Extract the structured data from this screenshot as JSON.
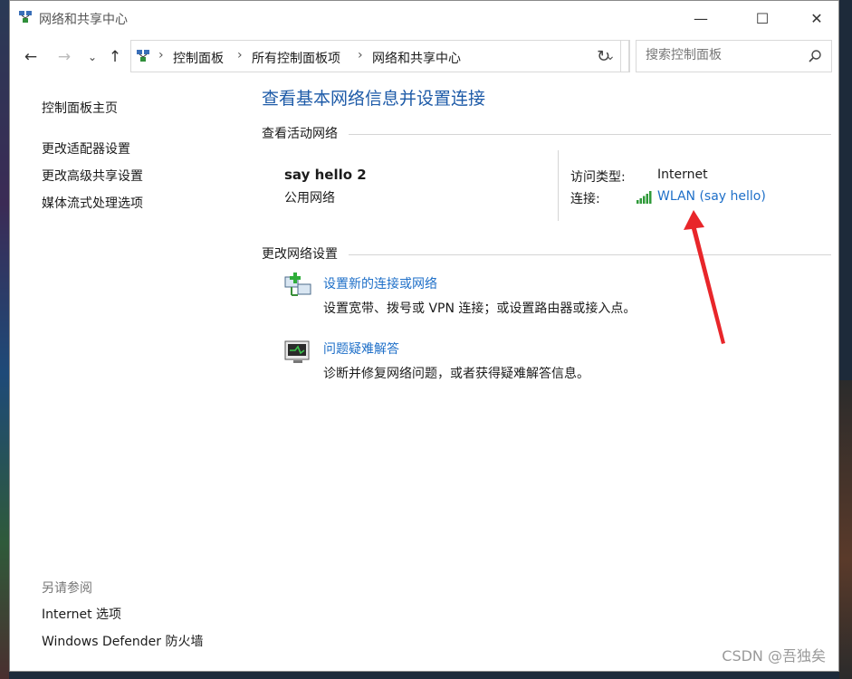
{
  "window": {
    "title": "网络和共享中心",
    "buttons": {
      "minimize": "—",
      "maximize": "☐",
      "close": "✕"
    }
  },
  "navigation": {
    "breadcrumbs": [
      "控制面板",
      "所有控制面板项",
      "网络和共享中心"
    ],
    "search_placeholder": "搜索控制面板"
  },
  "sidebar": {
    "home": "控制面板主页",
    "links": [
      "更改适配器设置",
      "更改高级共享设置",
      "媒体流式处理选项"
    ],
    "see_also_title": "另请参阅",
    "see_also": [
      "Internet 选项",
      "Windows Defender 防火墙"
    ]
  },
  "main": {
    "title": "查看基本网络信息并设置连接",
    "active_networks_header": "查看活动网络",
    "network": {
      "name": "say hello 2",
      "type": "公用网络",
      "access_type_label": "访问类型:",
      "access_type_value": "Internet",
      "connection_label": "连接:",
      "connection_value": "WLAN (say hello)"
    },
    "change_settings_header": "更改网络设置",
    "tasks": [
      {
        "title": "设置新的连接或网络",
        "description": "设置宽带、拨号或 VPN 连接；或设置路由器或接入点。",
        "icon": "network-setup-icon"
      },
      {
        "title": "问题疑难解答",
        "description": "诊断并修复网络问题，或者获得疑难解答信息。",
        "icon": "troubleshoot-icon"
      }
    ]
  },
  "watermark": "CSDN @吾独矣",
  "colors": {
    "link": "#1e6fc8",
    "title": "#1e5ba8",
    "annotation_arrow": "#e8262a"
  }
}
